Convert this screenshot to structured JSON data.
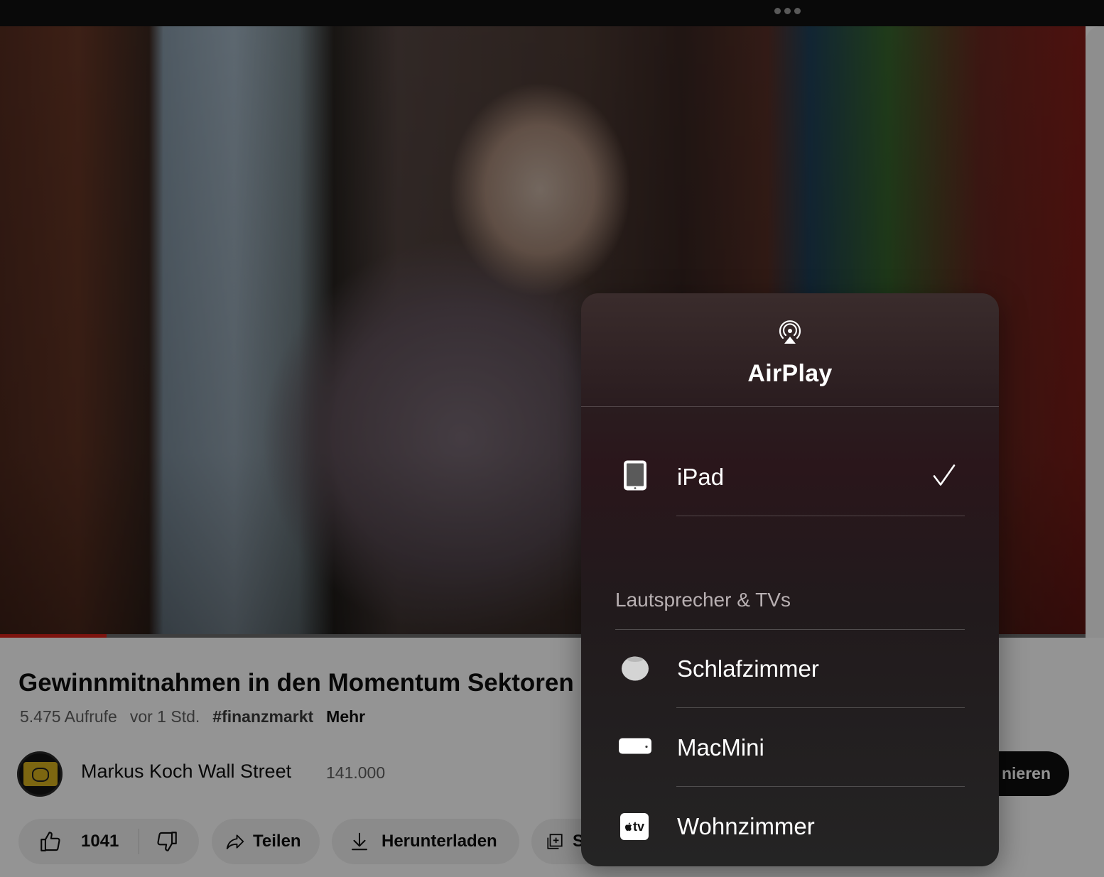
{
  "video": {
    "progress_fraction": 0.098
  },
  "details": {
    "title": "Gewinnmitnahmen in den Momentum Sektoren",
    "views": "5.475 Aufrufe",
    "age": "vor 1 Std.",
    "hashtag": "#finanzmarkt",
    "more_label": "Mehr"
  },
  "channel": {
    "name": "Markus Koch Wall Street",
    "subscribers": "141.000",
    "subscribe_label": "nieren"
  },
  "actions": {
    "like_count": "1041",
    "share_label": "Teilen",
    "download_label": "Herunterladen",
    "save_label": "S"
  },
  "airplay": {
    "title": "AirPlay",
    "current_device": "iPad",
    "section_label": "Lautsprecher & TVs",
    "devices": [
      {
        "label": "Schlafzimmer",
        "icon": "homepod-mini-icon"
      },
      {
        "label": "MacMini",
        "icon": "mac-mini-icon"
      },
      {
        "label": "Wohnzimmer",
        "icon": "apple-tv-icon"
      }
    ],
    "appletv_badge": "tv"
  }
}
